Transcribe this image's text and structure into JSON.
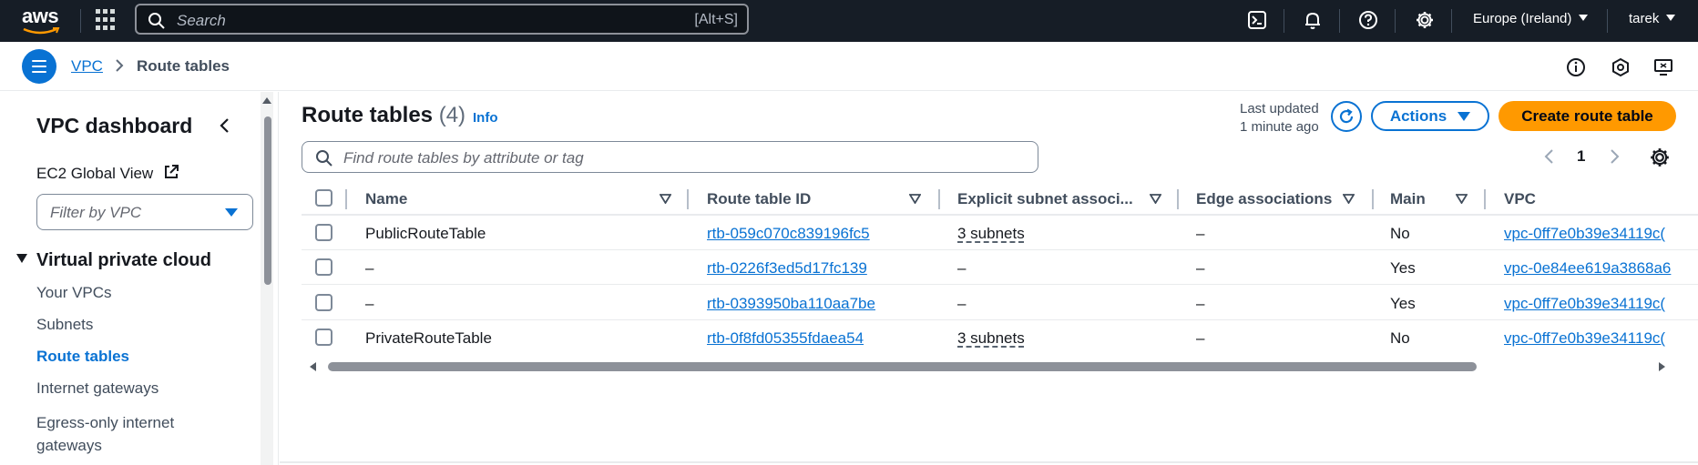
{
  "topbar": {
    "logo_text": "aws",
    "search_placeholder": "Search",
    "search_shortcut": "[Alt+S]",
    "region": "Europe (Ireland)",
    "user": "tarek"
  },
  "breadcrumb": {
    "items": [
      "VPC",
      "Route tables"
    ]
  },
  "sidebar": {
    "title": "VPC dashboard",
    "ec2_link": "EC2 Global View",
    "filter_placeholder": "Filter by VPC",
    "section": "Virtual private cloud",
    "items": [
      {
        "label": "Your VPCs",
        "active": false
      },
      {
        "label": "Subnets",
        "active": false
      },
      {
        "label": "Route tables",
        "active": true
      },
      {
        "label": "Internet gateways",
        "active": false
      },
      {
        "label": "Egress-only internet gateways",
        "active": false
      }
    ]
  },
  "header": {
    "title": "Route tables",
    "count": "(4)",
    "info": "Info",
    "last_updated_1": "Last updated",
    "last_updated_2": "1 minute ago",
    "actions_label": "Actions",
    "create_label": "Create route table"
  },
  "table": {
    "search_placeholder": "Find route tables by attribute or tag",
    "page": "1",
    "columns": [
      "Name",
      "Route table ID",
      "Explicit subnet associ...",
      "Edge associations",
      "Main",
      "VPC"
    ],
    "rows": [
      {
        "name": "PublicRouteTable",
        "id": "rtb-059c070c839196fc5",
        "subnet": "3 subnets",
        "edge": "–",
        "main": "No",
        "vpc": "vpc-0ff7e0b39e34119c("
      },
      {
        "name": "–",
        "id": "rtb-0226f3ed5d17fc139",
        "subnet": "–",
        "edge": "–",
        "main": "Yes",
        "vpc": "vpc-0e84ee619a3868a6"
      },
      {
        "name": "–",
        "id": "rtb-0393950ba110aa7be",
        "subnet": "–",
        "edge": "–",
        "main": "Yes",
        "vpc": "vpc-0ff7e0b39e34119c("
      },
      {
        "name": "PrivateRouteTable",
        "id": "rtb-0f8fd05355fdaea54",
        "subnet": "3 subnets",
        "edge": "–",
        "main": "No",
        "vpc": "vpc-0ff7e0b39e34119c("
      }
    ]
  },
  "colors": {
    "topbar": "#161d26",
    "link": "#0972d3",
    "primary_button": "#ff9900"
  }
}
